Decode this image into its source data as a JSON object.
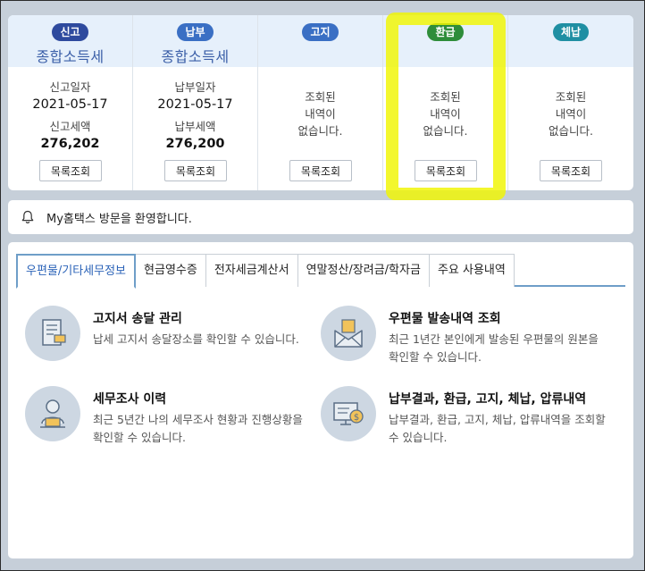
{
  "summary": {
    "columns": [
      {
        "badge": "신고",
        "title": "종합소득세",
        "date_label": "신고일자",
        "date": "2021-05-17",
        "amount_label": "신고세액",
        "amount": "276,202",
        "button": "목록조회"
      },
      {
        "badge": "납부",
        "title": "종합소득세",
        "date_label": "납부일자",
        "date": "2021-05-17",
        "amount_label": "납부세액",
        "amount": "276,200",
        "button": "목록조회"
      },
      {
        "badge": "고지",
        "empty_lines": [
          "조회된",
          "내역이",
          "없습니다."
        ],
        "button": "목록조회"
      },
      {
        "badge": "환급",
        "empty_lines": [
          "조회된",
          "내역이",
          "없습니다."
        ],
        "button": "목록조회"
      },
      {
        "badge": "체납",
        "empty_lines": [
          "조회된",
          "내역이",
          "없습니다."
        ],
        "button": "목록조회"
      }
    ]
  },
  "notice": {
    "icon": "bell-icon",
    "text": "My홈택스 방문을 환영합니다."
  },
  "tabs": [
    "우편물/기타세무정보",
    "현금영수증",
    "전자세금계산서",
    "연말정산/장려금/학자금",
    "주요 사용내역"
  ],
  "active_tab": "우편물/기타세무정보",
  "services": [
    {
      "icon": "document-icon",
      "title": "고지서 송달 관리",
      "desc": "납세 고지서 송달장소를 확인할 수 있습니다."
    },
    {
      "icon": "envelope-icon",
      "title": "우편물 발송내역 조회",
      "desc": "최근 1년간 본인에게 발송된 우편물의 원본을 확인할 수 있습니다."
    },
    {
      "icon": "person-laptop-icon",
      "title": "세무조사 이력",
      "desc": "최근 5년간 나의 세무조사 현황과 진행상황을 확인할 수 있습니다."
    },
    {
      "icon": "monitor-coin-icon",
      "title": "납부결과, 환급, 고지, 체납, 압류내역",
      "desc": "납부결과, 환급, 고지, 체납, 압류내역을 조회할 수 있습니다."
    }
  ],
  "colors": {
    "background": "#c6cfd9",
    "header_bg": "#e6f0fb",
    "accent_blue": "#2b63b8",
    "highlight": "#f0f500"
  }
}
